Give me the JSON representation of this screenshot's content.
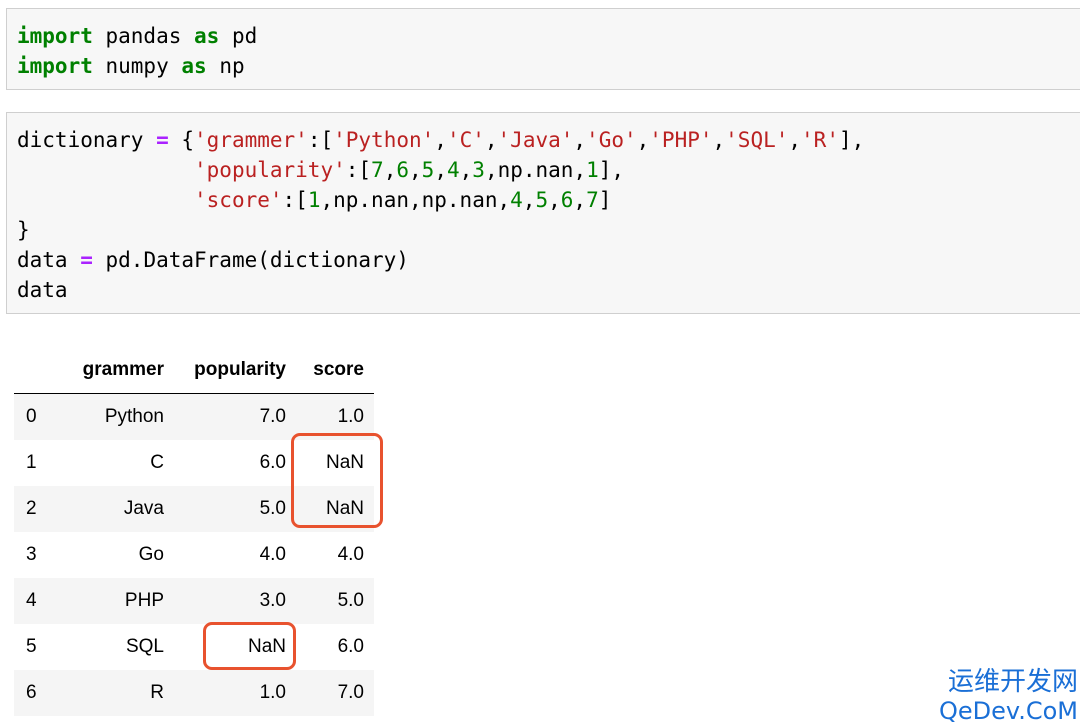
{
  "cell1": {
    "line1": {
      "kw1": "import",
      "name": " pandas ",
      "kw2": "as",
      "alias": " pd"
    },
    "line2": {
      "kw1": "import",
      "name": " numpy ",
      "kw2": "as",
      "alias": " np"
    }
  },
  "cell2": {
    "l1": {
      "p1": "dictionary ",
      "op": "=",
      "p2": " {",
      "s1": "'grammer'",
      "p3": ":[",
      "s2": "'Python'",
      "c1": ",",
      "s3": "'C'",
      "c2": ",",
      "s4": "'Java'",
      "c3": ",",
      "s5": "'Go'",
      "c4": ",",
      "s6": "'PHP'",
      "c5": ",",
      "s7": "'SQL'",
      "c6": ",",
      "s8": "'R'",
      "p4": "],"
    },
    "l2": {
      "indent": "              ",
      "s1": "'popularity'",
      "p1": ":[",
      "n1": "7",
      "c1": ",",
      "n2": "6",
      "c2": ",",
      "n3": "5",
      "c3": ",",
      "n4": "4",
      "c4": ",",
      "n5": "3",
      "p2": ",np.nan,",
      "n6": "1",
      "p3": "],"
    },
    "l3": {
      "indent": "              ",
      "s1": "'score'",
      "p1": ":[",
      "n1": "1",
      "p2": ",np.nan,np.nan,",
      "n2": "4",
      "c1": ",",
      "n3": "5",
      "c2": ",",
      "n4": "6",
      "c3": ",",
      "n5": "7",
      "p3": "]"
    },
    "l4": {
      "text": "}"
    },
    "l5": {
      "p1": "data ",
      "op": "=",
      "p2": " pd.DataFrame(dictionary)"
    },
    "l6": {
      "text": "data"
    }
  },
  "table": {
    "columns": [
      "",
      "grammer",
      "popularity",
      "score"
    ],
    "rows": [
      [
        "0",
        "Python",
        "7.0",
        "1.0"
      ],
      [
        "1",
        "C",
        "6.0",
        "NaN"
      ],
      [
        "2",
        "Java",
        "5.0",
        "NaN"
      ],
      [
        "3",
        "Go",
        "4.0",
        "4.0"
      ],
      [
        "4",
        "PHP",
        "3.0",
        "5.0"
      ],
      [
        "5",
        "SQL",
        "NaN",
        "6.0"
      ],
      [
        "6",
        "R",
        "1.0",
        "7.0"
      ]
    ]
  },
  "highlight_color": "#e8522e",
  "watermark": {
    "line1": "运维开发网",
    "line2": "QeDev.CoM"
  }
}
